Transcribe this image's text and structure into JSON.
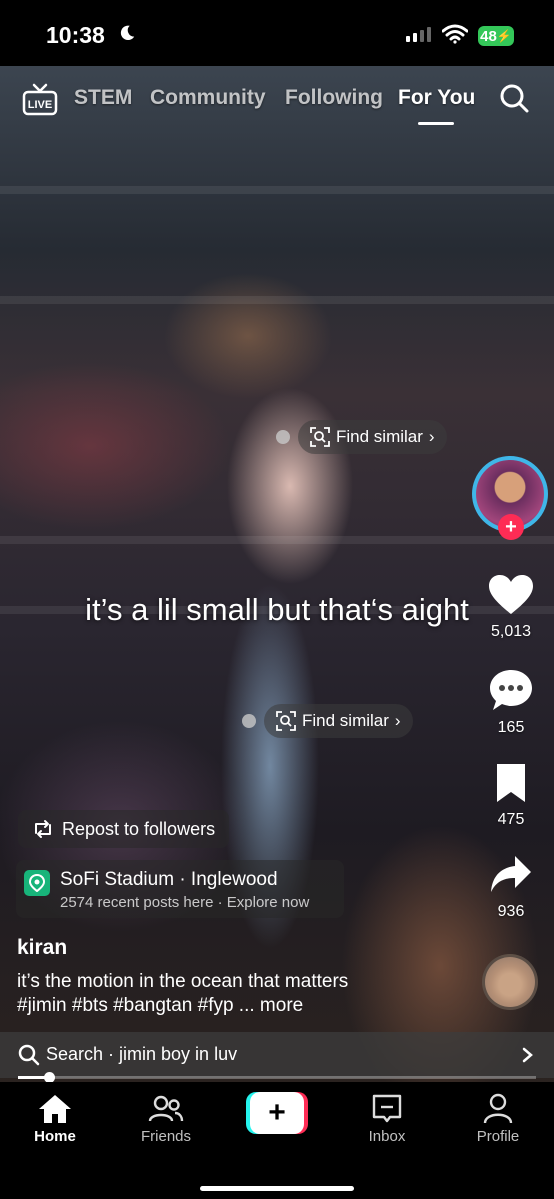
{
  "status_bar": {
    "time": "10:38",
    "battery": "48"
  },
  "top_nav": {
    "tabs": [
      {
        "label": "STEM"
      },
      {
        "label": "Community"
      },
      {
        "label": "Following"
      },
      {
        "label": "For You"
      }
    ],
    "live_label": "LIVE"
  },
  "overlays": {
    "find_similar_1": "Find similar",
    "find_similar_2": "Find similar",
    "caption": "it’s a lil small but that‘s aight"
  },
  "side_rail": {
    "likes": "5,013",
    "comments": "165",
    "saves": "475",
    "shares": "936"
  },
  "post": {
    "repost_label": "Repost to followers",
    "location_title": "SoFi Stadium · Inglewood",
    "location_subtitle": "2574 recent posts here · Explore now",
    "username": "kiran",
    "description_line1": "it’s the motion in the ocean that matters",
    "description_line2": "#jimin #bts #bangtan #fyp ... more"
  },
  "search_bar": {
    "text": "Search · jimin boy in luv"
  },
  "playback": {
    "progress_fraction": 0.06
  },
  "bottom_nav": {
    "items": [
      {
        "label": "Home"
      },
      {
        "label": "Friends"
      },
      {
        "label": "Inbox"
      },
      {
        "label": "Profile"
      }
    ]
  },
  "colors": {
    "accent_red": "#fe2c55",
    "accent_cyan": "#25f4ee",
    "location_green": "#18b47a",
    "battery_green": "#34c759"
  }
}
